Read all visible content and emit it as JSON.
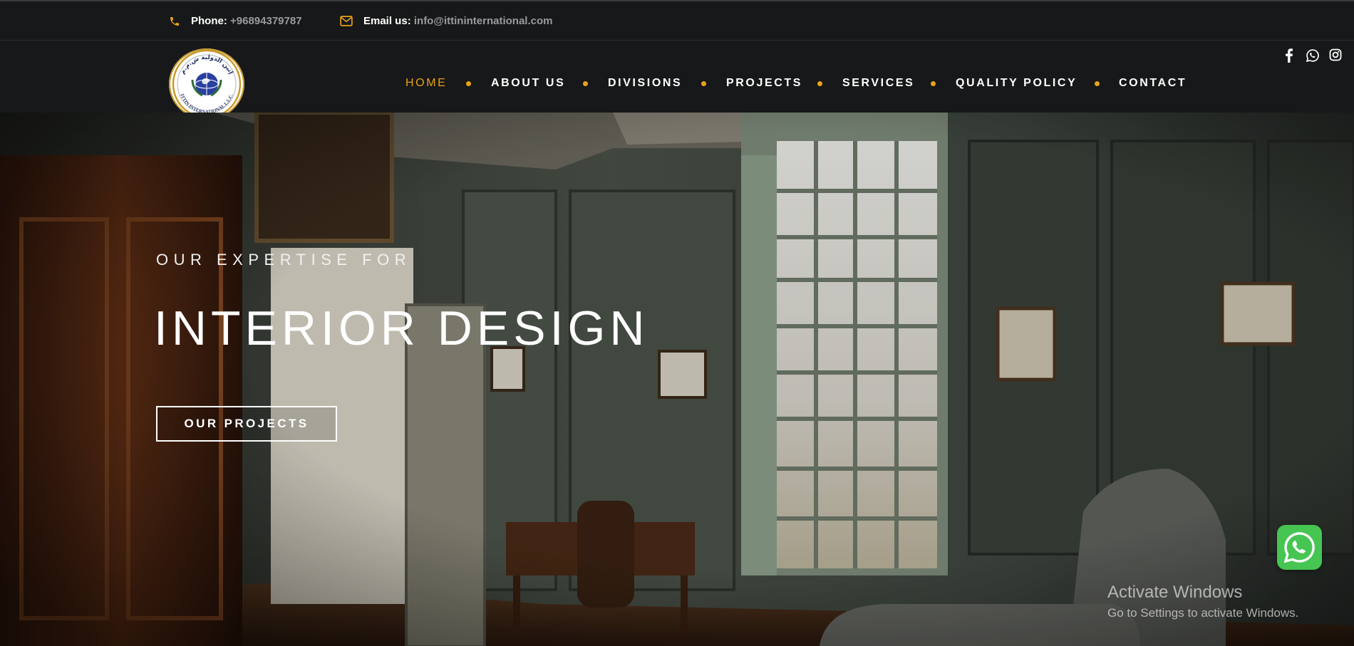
{
  "topbar": {
    "phone_label": "Phone:",
    "phone_value": "+96894379787",
    "email_label": "Email us:",
    "email_value": "info@ittininternational.com",
    "phone_icon": "phone-icon",
    "email_icon": "envelope-icon"
  },
  "logo": {
    "text_arabic": "إتين الدولية ش.م.م",
    "text_latin": "ITTIN INTERNATIONAL L.L.C."
  },
  "nav": {
    "items": [
      {
        "label": "HOME",
        "active": true
      },
      {
        "label": "ABOUT US",
        "active": false
      },
      {
        "label": "DIVISIONS",
        "active": false
      },
      {
        "label": "PROJECTS",
        "active": false
      },
      {
        "label": "SERVICES",
        "active": false
      },
      {
        "label": "QUALITY POLICY",
        "active": false
      },
      {
        "label": "CONTACT",
        "active": false
      }
    ]
  },
  "social": [
    "facebook-icon",
    "whatsapp-icon",
    "instagram-icon"
  ],
  "hero": {
    "kicker": "OUR EXPERTISE FOR",
    "headline": "INTERIOR DESIGN",
    "cta_label": "OUR PROJECTS"
  },
  "overlay": {
    "activate_title": "Activate Windows",
    "activate_sub": "Go to Settings to activate Windows."
  },
  "colors": {
    "accent": "#e9a21a",
    "bar_bg": "#171819",
    "whatsapp": "#46c553"
  }
}
